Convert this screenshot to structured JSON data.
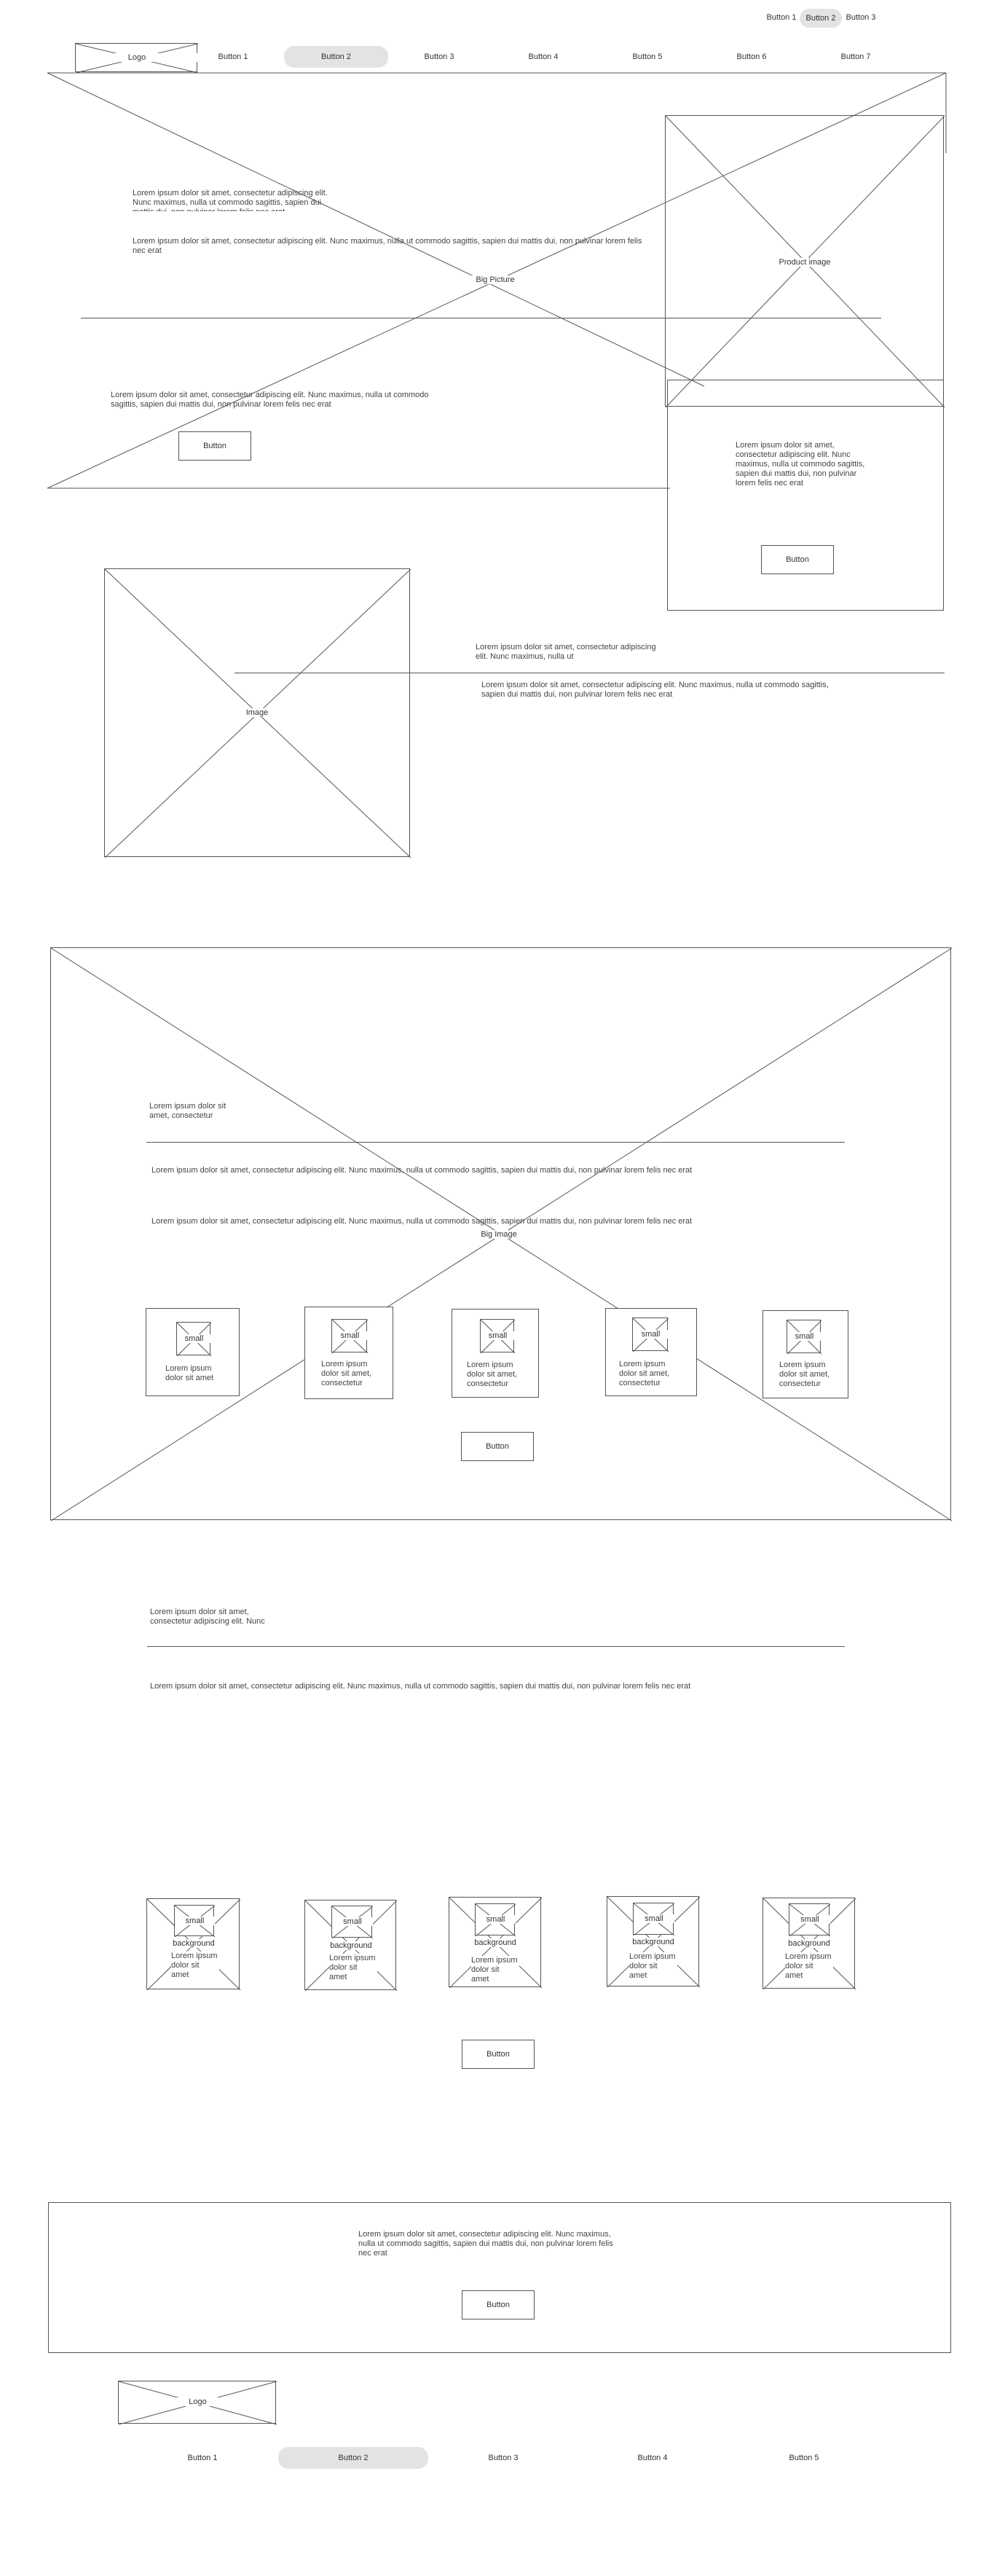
{
  "top_nav": {
    "button_1": "Button 1",
    "button_2": "Button 2",
    "button_3": "Button 3"
  },
  "header": {
    "logo": "Logo",
    "nav": [
      "Button 1",
      "Button 2",
      "Button 3",
      "Button 4",
      "Button 5",
      "Button 6",
      "Button 7"
    ]
  },
  "hero": {
    "big_picture_label": "Big Picture",
    "text_short": "Lorem ipsum dolor sit amet, consectetur adipiscing elit. Nunc maximus, nulla ut commodo sagittis, sapien dui mattis dui, non pulvinar lorem felis nec erat",
    "text_long": "Lorem ipsum dolor sit amet, consectetur adipiscing elit. Nunc maximus, nulla ut commodo sagittis, sapien dui mattis dui, non pulvinar lorem felis nec erat",
    "text_lower": "Lorem ipsum dolor sit amet, consectetur adipiscing elit. Nunc maximus, nulla ut commodo sagittis, sapien dui mattis dui, non pulvinar lorem felis nec erat",
    "button": "Button"
  },
  "product": {
    "image_label": "Product image",
    "text": "Lorem ipsum dolor sit amet, consectetur adipiscing elit. Nunc maximus, nulla ut commodo sagittis, sapien dui mattis dui, non pulvinar lorem felis nec erat",
    "button": "Button"
  },
  "image_section": {
    "image_label": "Image",
    "text_short": "Lorem ipsum dolor sit amet, consectetur adipiscing elit. Nunc maximus, nulla ut",
    "text_long": "Lorem ipsum dolor sit amet, consectetur adipiscing elit. Nunc maximus, nulla ut commodo sagittis, sapien dui mattis dui, non pulvinar lorem felis nec erat"
  },
  "big_image_section": {
    "big_image_label": "Big Image",
    "text_short": "Lorem ipsum dolor sit amet, consectetur",
    "text_1": "Lorem ipsum dolor sit amet, consectetur adipiscing elit. Nunc maximus, nulla ut commodo sagittis, sapien dui mattis dui, non pulvinar lorem felis nec erat",
    "text_2": "Lorem ipsum dolor sit amet, consectetur adipiscing elit. Nunc maximus, nulla ut commodo sagittis, sapien dui mattis dui, non pulvinar lorem felis nec erat",
    "cards": [
      {
        "small": "small",
        "text": "Lorem ipsum dolor sit amet"
      },
      {
        "small": "small",
        "text": "Lorem ipsum dolor sit amet, consectetur"
      },
      {
        "small": "small",
        "text": "Lorem ipsum dolor sit amet, consectetur"
      },
      {
        "small": "small",
        "text": "Lorem ipsum dolor sit amet, consectetur"
      },
      {
        "small": "small",
        "text": "Lorem ipsum dolor sit amet, consectetur"
      }
    ],
    "button": "Button"
  },
  "text_section": {
    "text_short": "Lorem ipsum dolor sit amet, consectetur adipiscing elit. Nunc",
    "text_long": "Lorem ipsum dolor sit amet, consectetur adipiscing elit. Nunc maximus, nulla ut commodo sagittis, sapien dui mattis dui, non pulvinar lorem felis nec erat"
  },
  "background_cards": {
    "cards": [
      {
        "small": "small",
        "bg": "background",
        "text": "Lorem ipsum dolor sit amet"
      },
      {
        "small": "small",
        "bg": "background",
        "text": "Lorem ipsum dolor sit amet"
      },
      {
        "small": "small",
        "bg": "background",
        "text": "Lorem ipsum dolor sit amet"
      },
      {
        "small": "small",
        "bg": "background",
        "text": "Lorem ipsum dolor sit amet"
      },
      {
        "small": "small",
        "bg": "background",
        "text": "Lorem ipsum dolor sit amet"
      }
    ],
    "button": "Button"
  },
  "cta": {
    "text": "Lorem ipsum dolor sit amet, consectetur adipiscing elit. Nunc maximus, nulla ut commodo sagittis, sapien dui mattis dui, non pulvinar lorem felis nec erat",
    "button": "Button"
  },
  "footer": {
    "logo": "Logo",
    "nav": [
      "Button 1",
      "Button 2",
      "Button 3",
      "Button 4",
      "Button 5"
    ]
  },
  "colors": {
    "line": "#555555",
    "pill": "#e3e3e3",
    "background": "#ffffff"
  }
}
